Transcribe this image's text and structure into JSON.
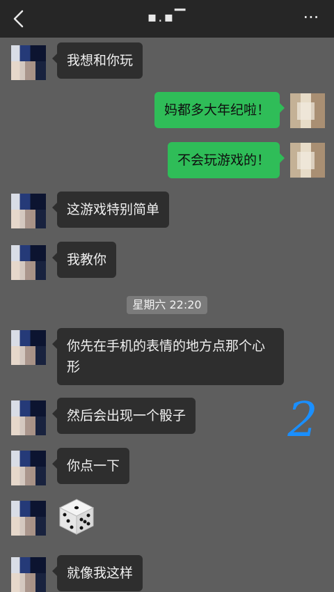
{
  "header": {
    "back_icon": "chevron-left-icon",
    "title": "▪.▪▔",
    "more_icon": "more-dots-icon",
    "more_label": "···"
  },
  "messages": [
    {
      "side": "friend",
      "text": "我想和你玩"
    },
    {
      "side": "me",
      "text": "妈都多大年纪啦！"
    },
    {
      "side": "me",
      "text": "不会玩游戏的！"
    },
    {
      "side": "friend",
      "text": "这游戏特别简单"
    },
    {
      "side": "friend",
      "text": "我教你"
    },
    {
      "side": "friend",
      "text": "你先在手机的表情的地方点那个心形"
    },
    {
      "side": "friend",
      "text": "然后会出现一个骰子"
    },
    {
      "side": "friend",
      "text": "你点一下"
    },
    {
      "side": "friend",
      "sticker": "dice-icon"
    },
    {
      "side": "friend",
      "text": "就像我这样"
    }
  ],
  "timestamp": "星期六 22:20",
  "annotation": "2",
  "colors": {
    "background": "#5e5e5e",
    "header": "#262626",
    "my_bubble": "#2fbd58",
    "friend_bubble": "#2e2e2e",
    "annotation_ink": "#1a8fff"
  }
}
